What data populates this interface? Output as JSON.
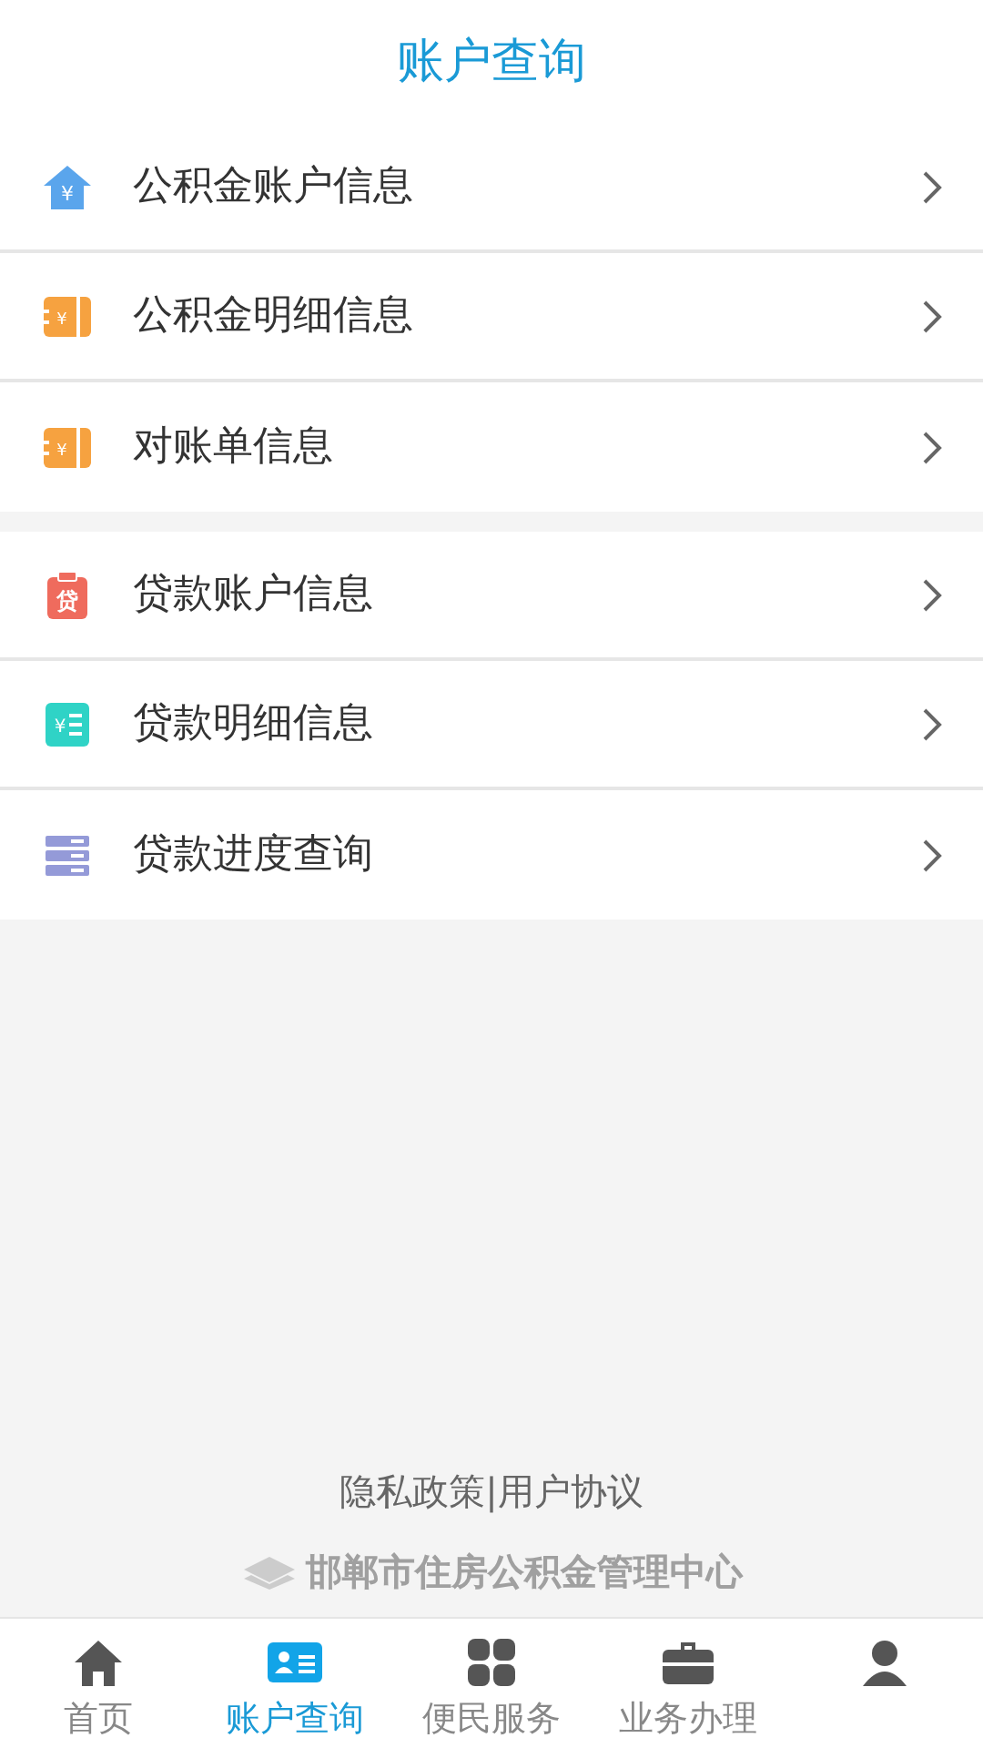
{
  "header": {
    "title": "账户查询"
  },
  "groups": [
    {
      "items": [
        {
          "label": "公积金账户信息",
          "kind": "house",
          "icon_text": "¥"
        },
        {
          "label": "公积金明细信息",
          "kind": "ticket",
          "icon_text": "¥"
        },
        {
          "label": "对账单信息",
          "kind": "ticket",
          "icon_text": "¥"
        }
      ]
    },
    {
      "items": [
        {
          "label": "贷款账户信息",
          "kind": "clipboard",
          "icon_text": "贷"
        },
        {
          "label": "贷款明细信息",
          "kind": "list",
          "icon_text": "¥"
        },
        {
          "label": "贷款进度查询",
          "kind": "stack"
        }
      ]
    }
  ],
  "footer": {
    "links": [
      "隐私政策",
      "用户协议"
    ],
    "separator": "|",
    "logo_text": "邯郸市住房公积金管理中心"
  },
  "tabs": [
    {
      "label": "首页",
      "kind": "home",
      "selected": false
    },
    {
      "label": "账户查询",
      "kind": "card",
      "selected": true
    },
    {
      "label": "便民服务",
      "kind": "grid",
      "selected": false
    },
    {
      "label": "业务办理",
      "kind": "briefcase",
      "selected": false
    },
    {
      "kind": "person",
      "selected": false
    }
  ]
}
